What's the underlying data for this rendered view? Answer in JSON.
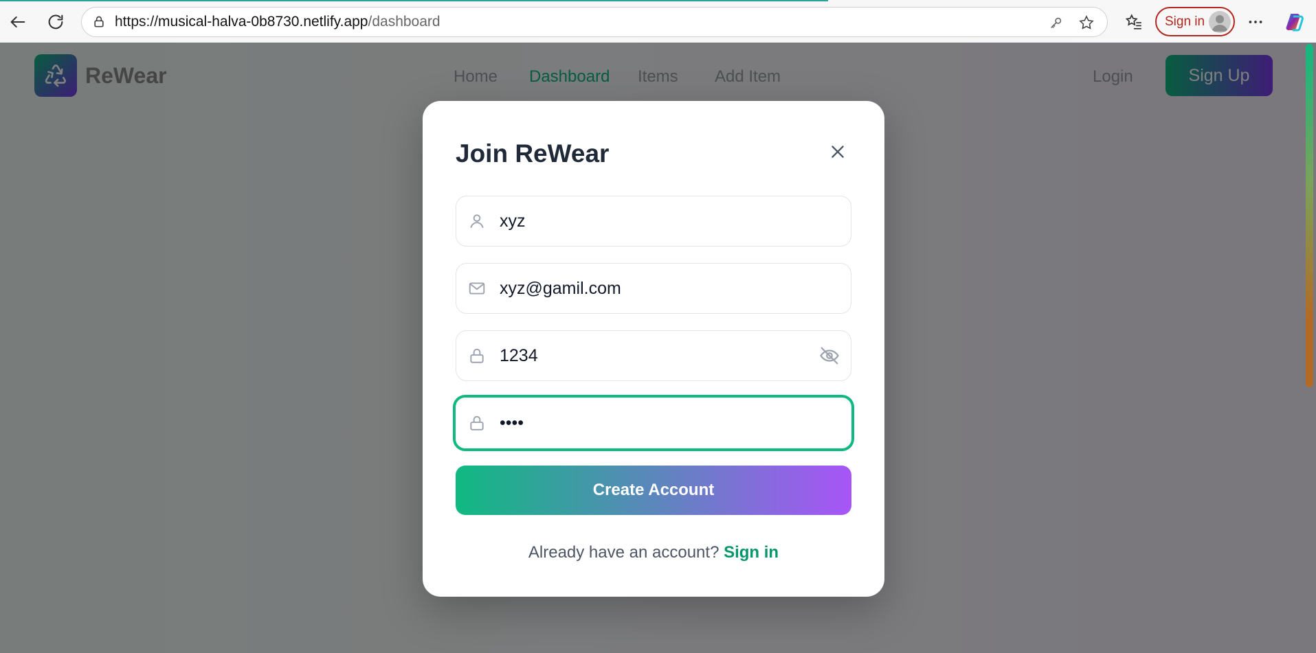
{
  "browser": {
    "url_prefix": "https://",
    "url_host": "musical-halva-0b8730.netlify.app",
    "url_path": "/dashboard",
    "signin_label": "Sign in"
  },
  "app": {
    "brand": "ReWear",
    "nav": [
      "Home",
      "Dashboard",
      "Items",
      "Add Item"
    ],
    "active_nav": "Dashboard",
    "login_label": "Login",
    "signup_label": "Sign Up",
    "colors": {
      "accent_green": "#10b981",
      "accent_purple": "#a855f7"
    }
  },
  "modal": {
    "title": "Join ReWear",
    "fields": {
      "name": {
        "value": "xyz",
        "icon": "user-icon"
      },
      "email": {
        "value": "xyz@gamil.com",
        "icon": "mail-icon"
      },
      "password": {
        "value": "1234",
        "icon": "lock-icon"
      },
      "confirm_password": {
        "value": "••••",
        "icon": "lock-icon"
      }
    },
    "create_label": "Create Account",
    "footer_text": "Already have an account?",
    "footer_link": "Sign in"
  }
}
